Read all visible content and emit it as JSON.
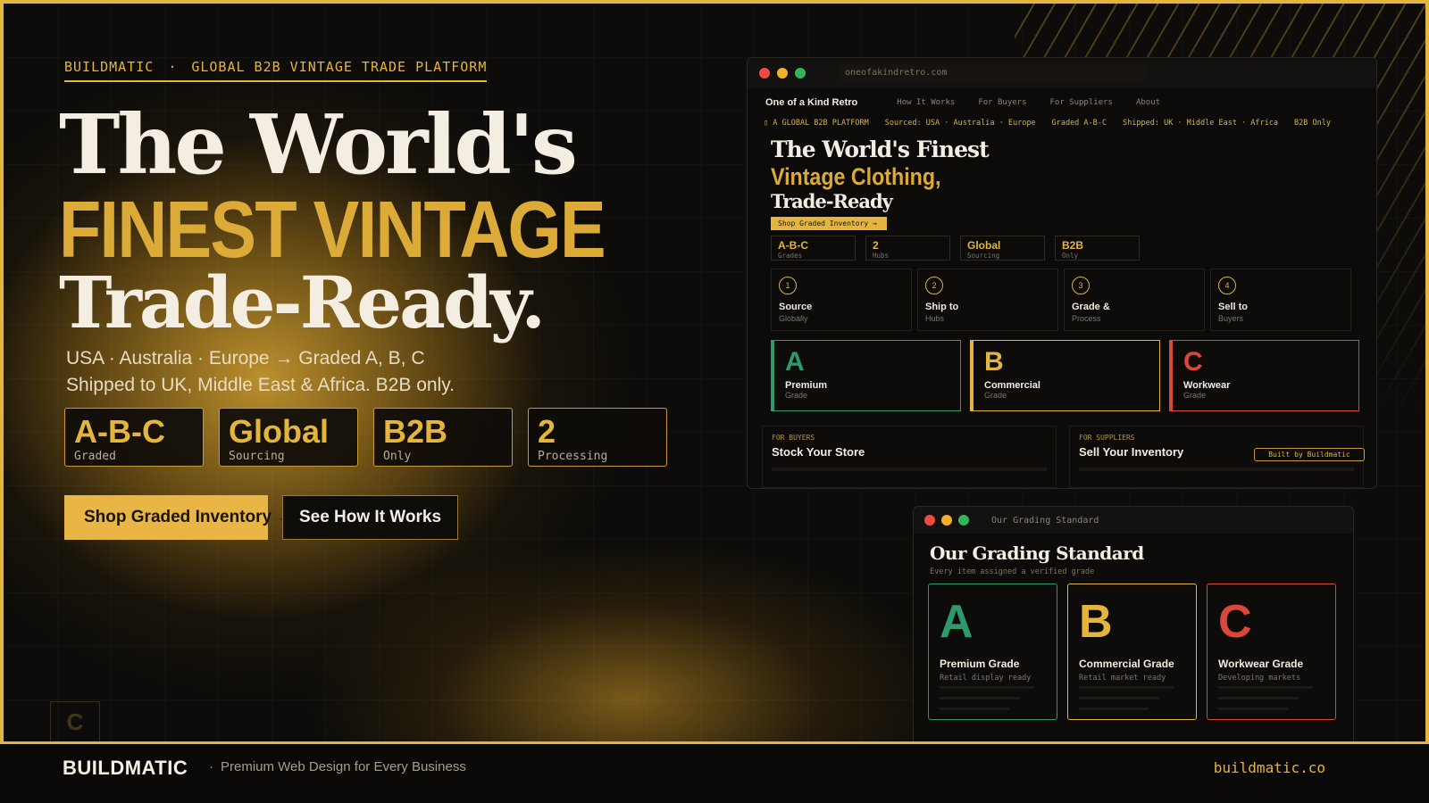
{
  "colors": {
    "gold": "#e3b53c",
    "grade_a": "#2e9a6b",
    "grade_b": "#e3b53c",
    "grade_c": "#d9483a"
  },
  "hero": {
    "eyebrow_brand": "BUILDMATIC",
    "eyebrow_sep": "·",
    "eyebrow_text": "GLOBAL B2B VINTAGE TRADE PLATFORM",
    "line1": "The World's",
    "line2": "FINEST VINTAGE",
    "line3": "Trade-Ready.",
    "sub1": "USA · Australia · Europe → Graded A, B, C",
    "sub2": "Shipped to UK, Middle East & Africa. B2B only.",
    "stats": [
      {
        "value": "A-B-C",
        "label": "Graded"
      },
      {
        "value": "Global",
        "label": "Sourcing"
      },
      {
        "value": "B2B",
        "label": "Only"
      },
      {
        "value": "2",
        "label": "Processing"
      }
    ],
    "cta_primary": "Shop Graded Inventory →",
    "cta_secondary": "See How It Works",
    "ghost_letter": "C"
  },
  "footer": {
    "logo": "BUILDMATIC",
    "dot": "·",
    "tagline": "Premium Web Design for Every Business",
    "url": "buildmatic.co"
  },
  "browser1": {
    "url": "oneofakindretro.com",
    "brand": "One of a Kind Retro",
    "nav": [
      "How It Works",
      "For Buyers",
      "For Suppliers",
      "About"
    ],
    "ticker": [
      "▯ A GLOBAL B2B PLATFORM",
      "Sourced: USA · Australia · Europe",
      "Graded A-B-C",
      "Shipped: UK · Middle East · Africa",
      "B2B Only"
    ],
    "title": "The World's Finest",
    "gold": "Vintage Clothing,",
    "trade": "Trade-Ready",
    "button": "Shop Graded Inventory →",
    "stats": [
      {
        "value": "A-B-C",
        "label": "Grades"
      },
      {
        "value": "2",
        "label": "Hubs"
      },
      {
        "value": "Global",
        "label": "Sourcing"
      },
      {
        "value": "B2B",
        "label": "Only"
      }
    ],
    "steps": [
      {
        "num": "1",
        "title": "Source",
        "sub": "Globally"
      },
      {
        "num": "2",
        "title": "Ship to",
        "sub": "Hubs"
      },
      {
        "num": "3",
        "title": "Grade &",
        "sub": "Process"
      },
      {
        "num": "4",
        "title": "Sell to",
        "sub": "Buyers"
      }
    ],
    "grades": [
      {
        "letter": "A",
        "name": "Premium",
        "sub": "Grade"
      },
      {
        "letter": "B",
        "name": "Commercial",
        "sub": "Grade"
      },
      {
        "letter": "C",
        "name": "Workwear",
        "sub": "Grade"
      }
    ],
    "buyers_kicker": "FOR BUYERS",
    "buyers_title": "Stock Your Store",
    "suppliers_kicker": "FOR SUPPLIERS",
    "suppliers_title": "Sell Your Inventory",
    "badge": "Built by Buildmatic"
  },
  "browser2": {
    "tab": "Our Grading Standard",
    "title": "Our Grading Standard",
    "sub": "Every item assigned a verified grade",
    "grades": [
      {
        "letter": "A",
        "name": "Premium Grade",
        "sub": "Retail display ready"
      },
      {
        "letter": "B",
        "name": "Commercial Grade",
        "sub": "Retail market ready"
      },
      {
        "letter": "C",
        "name": "Workwear Grade",
        "sub": "Developing markets"
      }
    ]
  }
}
